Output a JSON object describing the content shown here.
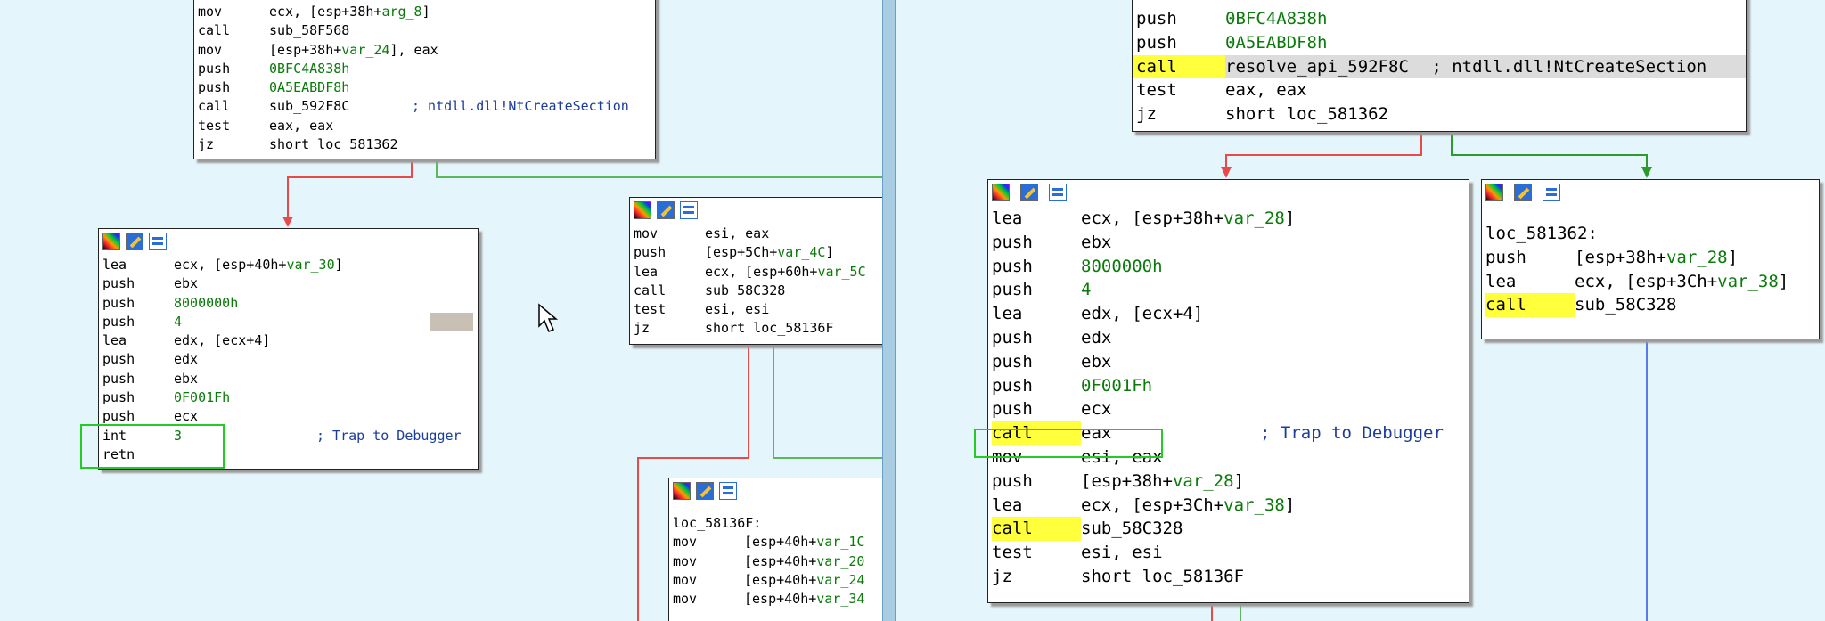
{
  "left": {
    "top_block": [
      {
        "m": "mov",
        "o": "ecx, [esp+38h+",
        "v": "arg_8",
        "e": "]"
      },
      {
        "m": "call",
        "o": "sub_58F568"
      },
      {
        "m": "mov",
        "o": "[esp+38h+",
        "v": "var_24",
        "e": "], eax"
      },
      {
        "m": "push",
        "n": "0BFC4A838h"
      },
      {
        "m": "push",
        "n": "0A5EABDF8h"
      },
      {
        "m": "call",
        "o": "sub_592F8C",
        "c": "; ntdll.dll!NtCreateSection"
      },
      {
        "m": "test",
        "o": "eax, eax"
      },
      {
        "m": "jz",
        "o": "short loc 581362"
      }
    ],
    "int_block": [
      {
        "m": "lea",
        "o": "ecx, [esp+40h+",
        "v": "var_30",
        "e": "]"
      },
      {
        "m": "push",
        "o": "ebx"
      },
      {
        "m": "push",
        "n": "8000000h"
      },
      {
        "m": "push",
        "n": "4"
      },
      {
        "m": "lea",
        "o": "edx, [ecx+4]"
      },
      {
        "m": "push",
        "o": "edx"
      },
      {
        "m": "push",
        "o": "ebx"
      },
      {
        "m": "push",
        "n": "0F001Fh"
      },
      {
        "m": "push",
        "o": "ecx"
      },
      {
        "m": "int",
        "n": "3",
        "c": "; Trap to Debugger"
      },
      {
        "m": "retn",
        "o": ""
      }
    ],
    "mid_block": [
      {
        "m": "mov",
        "o": "esi, eax"
      },
      {
        "m": "push",
        "o": "[esp+5Ch+",
        "v": "var_4C",
        "e": "]"
      },
      {
        "m": "lea",
        "o": "ecx, [esp+60h+",
        "v": "var_5C",
        "e": ""
      },
      {
        "m": "call",
        "o": "sub_58C328"
      },
      {
        "m": "test",
        "o": "esi, esi"
      },
      {
        "m": "jz",
        "o": "short loc_58136F"
      }
    ],
    "loc_block_label": "loc_58136F:",
    "loc_block": [
      {
        "m": "mov",
        "o": "[esp+40h+",
        "v": "var_1C",
        "e": ""
      },
      {
        "m": "mov",
        "o": "[esp+40h+",
        "v": "var_20",
        "e": ""
      },
      {
        "m": "mov",
        "o": "[esp+40h+",
        "v": "var_24",
        "e": ""
      },
      {
        "m": "mov",
        "o": "[esp+40h+",
        "v": "var_34",
        "e": ""
      }
    ]
  },
  "right": {
    "top_block": [
      {
        "m": "push",
        "n": "0BFC4A838h"
      },
      {
        "m": "push",
        "n": "0A5EABDF8h"
      },
      {
        "m": "call",
        "o": "resolve_api_592F8C",
        "c": " ; ntdll.dll!NtCreateSection",
        "plain_comment": true
      },
      {
        "m": "test",
        "o": "eax, eax"
      },
      {
        "m": "jz",
        "o": "short loc_581362"
      }
    ],
    "call_block": [
      {
        "m": "lea",
        "o": "ecx, [esp+38h+",
        "v": "var_28",
        "e": "]"
      },
      {
        "m": "push",
        "o": "ebx"
      },
      {
        "m": "push",
        "n": "8000000h"
      },
      {
        "m": "push",
        "n": "4"
      },
      {
        "m": "lea",
        "o": "edx, [ecx+4]"
      },
      {
        "m": "push",
        "o": "edx"
      },
      {
        "m": "push",
        "o": "ebx"
      },
      {
        "m": "push",
        "n": "0F001Fh"
      },
      {
        "m": "push",
        "o": "ecx"
      },
      {
        "m": "call",
        "o": "eax",
        "c": "; Trap to Debugger"
      },
      {
        "m": "mov",
        "o": "esi, eax"
      },
      {
        "m": "push",
        "o": "[esp+38h+",
        "v": "var_28",
        "e": "]"
      },
      {
        "m": "lea",
        "o": "ecx, [esp+3Ch+",
        "v": "var_38",
        "e": "]"
      },
      {
        "m": "call",
        "o": "sub_58C328"
      },
      {
        "m": "test",
        "o": "esi, esi"
      },
      {
        "m": "jz",
        "o": "short loc_58136F"
      }
    ],
    "loc_block_label": "loc_581362:",
    "loc_block": [
      {
        "m": "push",
        "o": "[esp+38h+",
        "v": "var_28",
        "e": "]"
      },
      {
        "m": "lea",
        "o": "ecx, [esp+3Ch+",
        "v": "var_38",
        "e": "]"
      },
      {
        "m": "call",
        "o": "sub_58C328"
      }
    ]
  }
}
